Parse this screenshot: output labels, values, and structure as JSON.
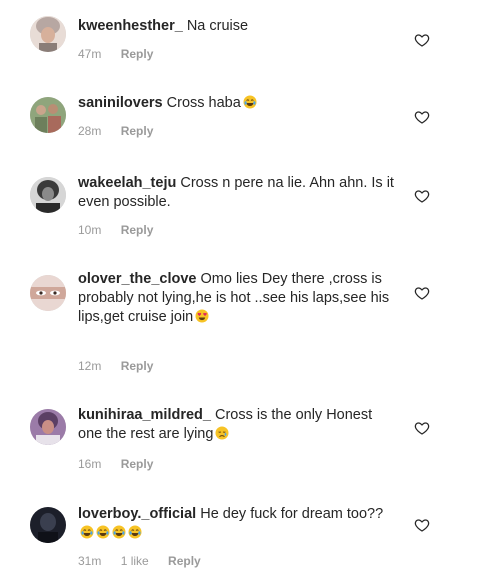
{
  "comments": [
    {
      "username": "kweenhesther_",
      "text": "Na cruise",
      "time": "47m",
      "likes": "",
      "reply": "Reply",
      "avatar": "avatar-woman-headwrap",
      "emoji": ""
    },
    {
      "username": "saninilovers",
      "text": "Cross haba",
      "time": "28m",
      "likes": "",
      "reply": "Reply",
      "avatar": "avatar-group-photo",
      "emoji": "😂"
    },
    {
      "username": "wakeelah_teju",
      "text": "Cross n pere na lie. Ahn ahn. Is it even possible.",
      "time": "10m",
      "likes": "",
      "reply": "Reply",
      "avatar": "avatar-bw-portrait",
      "emoji": ""
    },
    {
      "username": "olover_the_clove",
      "text": "Omo lies Dey there ,cross is probably not lying,he is hot ..see his laps,see his lips,get cruise join",
      "time": "12m",
      "likes": "",
      "reply": "Reply",
      "avatar": "avatar-eyes-closeup",
      "emoji": "😍"
    },
    {
      "username": "kunihiraa_mildred_",
      "text": "Cross is the  only Honest one the rest are lying",
      "time": "16m",
      "likes": "",
      "reply": "Reply",
      "avatar": "avatar-purple-portrait",
      "emoji": "😢"
    },
    {
      "username": "loverboy._official",
      "text": "He dey fuck for dream too??",
      "time": "31m",
      "likes": "1 like",
      "reply": "Reply",
      "avatar": "avatar-dark-portrait",
      "emoji": "😂😂😂😂"
    }
  ],
  "icons": {
    "like": "heart-outline-icon"
  },
  "colors": {
    "text": "#262626",
    "meta": "#9a9a9a",
    "background": "#ffffff"
  }
}
